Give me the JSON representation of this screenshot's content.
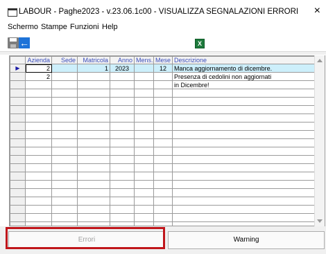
{
  "window": {
    "title": "LABOUR - Paghe2023 - v.23.06.1c00 - VISUALIZZA SEGNALAZIONI ERRORI",
    "close_glyph": "×"
  },
  "menu": [
    {
      "label": "Schermo"
    },
    {
      "label": "Stampe"
    },
    {
      "label": "Funzioni"
    },
    {
      "label": "Help"
    }
  ],
  "toolbar": {
    "icons": [
      "save-icon",
      "back-arrow-icon",
      "excel-export-icon"
    ],
    "back_glyph": "←",
    "excel_glyph": "X"
  },
  "grid": {
    "columns": [
      "Azienda",
      "Sede",
      "Matricola",
      "Anno",
      "Mens.",
      "Mese",
      "Descrizione"
    ],
    "current_row_marker": "▶",
    "rows": [
      {
        "azienda": "2",
        "sede": "",
        "matricola": "1",
        "anno": "2023",
        "mens": "",
        "mese": "12",
        "descrizione": "Manca aggiornamento di dicembre."
      },
      {
        "azienda": "2",
        "sede": "",
        "matricola": "",
        "anno": "",
        "mens": "",
        "mese": "",
        "descrizione": "Presenza di cedolini non aggiornati"
      },
      {
        "azienda": "",
        "sede": "",
        "matricola": "",
        "anno": "",
        "mens": "",
        "mese": "",
        "descrizione": "in Dicembre!"
      }
    ]
  },
  "buttons": {
    "errori": "Errori",
    "warning": "Warning"
  },
  "colors": {
    "highlight": "#c0161b",
    "selected_row": "#cdeffb",
    "header_text": "#3a4dbb"
  }
}
